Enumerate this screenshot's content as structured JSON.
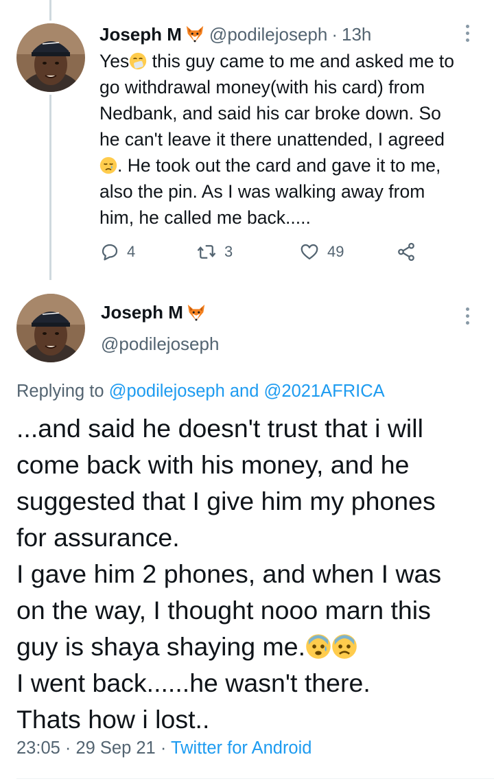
{
  "tweet1": {
    "name": "Joseph M",
    "handle": "@podilejoseph",
    "separator": "·",
    "time": "13h",
    "lines": [
      "Yes",
      " this guy came to me and asked me to",
      "go withdrawal money(with his card) from",
      "Nedbank, and said his car broke down. So",
      "he can't leave it there unattended, I agreed",
      ". He took out the card and gave it to me,",
      "also the pin. As I was walking away from",
      "him, he called me back....."
    ],
    "stats": {
      "replies": "4",
      "retweets": "3",
      "likes": "49"
    }
  },
  "tweet2": {
    "name": "Joseph M",
    "handle": "@podilejoseph",
    "replying_prefix": "Replying to",
    "reply_to_1": "@podilejoseph",
    "reply_and": "and",
    "reply_to_2": "@2021AFRICA",
    "lines": [
      "...and said he doesn't trust that i will",
      "come back with his money, and he",
      "suggested that I give him my phones",
      "for assurance.",
      "I gave him 2 phones, and when I was",
      "on the way, I thought nooo marn this",
      "guy is shaya shaying me.",
      "I went back......he wasn't there.",
      "Thats how i lost.."
    ],
    "timestamp": "23:05 · 29 Sep 21 ·",
    "client": "Twitter for Android"
  },
  "colors": {
    "text": "#0f1419",
    "secondary": "#536471",
    "link": "#1d9bf0",
    "thread": "#cfd9de"
  },
  "icons": [
    "fox-emoji-icon",
    "sneezing-face-emoji-icon",
    "crying-face-emoji-icon",
    "anxious-face-emoji-icon",
    "fearful-face-emoji-icon",
    "reply-icon",
    "retweet-icon",
    "like-icon",
    "share-icon",
    "more-icon"
  ]
}
